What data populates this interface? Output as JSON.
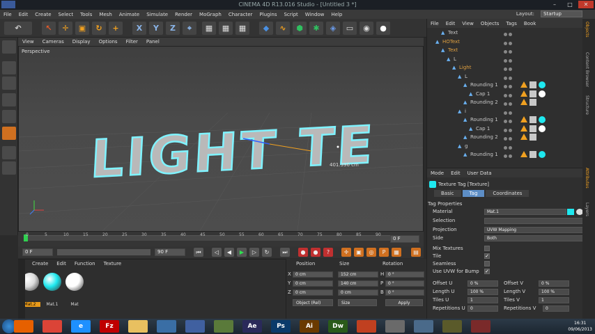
{
  "window": {
    "title": "CINEMA 4D R13.016 Studio - [Untitled 3 *]",
    "min": "–",
    "max": "□",
    "close": "✕"
  },
  "menubar": [
    "File",
    "Edit",
    "Create",
    "Select",
    "Tools",
    "Mesh",
    "Animate",
    "Simulate",
    "Render",
    "MoGraph",
    "Character",
    "Plugins",
    "Script",
    "Window",
    "Help"
  ],
  "layout": {
    "label": "Layout:",
    "value": "Startup"
  },
  "viewport": {
    "menu": [
      "View",
      "Cameras",
      "Display",
      "Options",
      "Filter",
      "Panel"
    ],
    "label": "Perspective",
    "text3d": "LIGHT TE",
    "measure": "401.396 cm",
    "accent": "#7ff3ff"
  },
  "timeline": {
    "ticks": [
      "0",
      "5",
      "10",
      "15",
      "20",
      "25",
      "30",
      "35",
      "40",
      "45",
      "50",
      "55",
      "60",
      "65",
      "70",
      "75",
      "80",
      "85",
      "90"
    ],
    "end_field": "0 F"
  },
  "playbar": {
    "start": "0 F",
    "mid": "0 F",
    "end": "90 F"
  },
  "materials": {
    "menu": [
      "Create",
      "Edit",
      "Function",
      "Texture"
    ],
    "items": [
      {
        "label": "Mat.2",
        "color": "#dcdcdc"
      },
      {
        "label": "Mat.1",
        "color": "#1ee8ef"
      },
      {
        "label": "Mat",
        "color": "#ffffff"
      }
    ]
  },
  "coords": {
    "headers": {
      "position": "Position",
      "size": "Size",
      "rotation": "Rotation"
    },
    "rows": [
      {
        "axis": "X",
        "pos": "0 cm",
        "size": "152 cm",
        "rot_axis": "H",
        "rot": "0 °"
      },
      {
        "axis": "Y",
        "pos": "0 cm",
        "size": "140 cm",
        "rot_axis": "P",
        "rot": "0 °"
      },
      {
        "axis": "Z",
        "pos": "0 cm",
        "size": "0 cm",
        "rot_axis": "B",
        "rot": "0 °"
      }
    ],
    "mode": "Object (Rel)",
    "size_mode": "Size",
    "apply": "Apply"
  },
  "objects": {
    "menu": [
      "File",
      "Edit",
      "View",
      "Objects",
      "Tags",
      "Book"
    ],
    "rows": [
      {
        "name": "Text",
        "indent": 1,
        "color": "#c8c8c8",
        "tags": []
      },
      {
        "name": "HOText",
        "indent": 0,
        "color": "#e0a040",
        "tags": []
      },
      {
        "name": "Text",
        "indent": 1,
        "color": "#e0a040",
        "tags": []
      },
      {
        "name": "L",
        "indent": 2,
        "color": "#c8c8c8",
        "tags": []
      },
      {
        "name": "Light",
        "indent": 3,
        "color": "#e0a040",
        "tags": []
      },
      {
        "name": "L",
        "indent": 4,
        "color": "#c8c8c8",
        "tags": []
      },
      {
        "name": "Rounding 1",
        "indent": 5,
        "color": "#c8c8c8",
        "tags": [
          "phong",
          "check",
          "cyan"
        ]
      },
      {
        "name": "Cap 1",
        "indent": 6,
        "color": "#c8c8c8",
        "tags": [
          "phong",
          "check",
          "white"
        ]
      },
      {
        "name": "Rounding 2",
        "indent": 5,
        "color": "#c8c8c8",
        "tags": [
          "phong",
          "check"
        ]
      },
      {
        "name": "i",
        "indent": 4,
        "color": "#c8c8c8",
        "tags": []
      },
      {
        "name": "Rounding 1",
        "indent": 5,
        "color": "#c8c8c8",
        "tags": [
          "phong",
          "check",
          "cyan"
        ]
      },
      {
        "name": "Cap 1",
        "indent": 6,
        "color": "#c8c8c8",
        "tags": [
          "phong",
          "check",
          "white"
        ]
      },
      {
        "name": "Rounding 2",
        "indent": 5,
        "color": "#c8c8c8",
        "tags": [
          "phong",
          "check"
        ]
      },
      {
        "name": "g",
        "indent": 4,
        "color": "#c8c8c8",
        "tags": []
      },
      {
        "name": "Rounding 1",
        "indent": 5,
        "color": "#c8c8c8",
        "tags": [
          "phong",
          "check",
          "cyan"
        ]
      }
    ]
  },
  "attributes": {
    "menu": [
      "Mode",
      "Edit",
      "User Data"
    ],
    "title": "Texture Tag [Texture]",
    "tabs": [
      "Basic",
      "Tag",
      "Coordinates"
    ],
    "active_tab": "Tag",
    "section": "Tag Properties",
    "props": [
      {
        "label": "Material",
        "value": "Mat.1"
      },
      {
        "label": "Selection",
        "value": ""
      },
      {
        "label": "Projection",
        "value": "UVW Mapping"
      },
      {
        "label": "Side",
        "value": "Both"
      }
    ],
    "checks": [
      {
        "label": "Mix Textures",
        "checked": false,
        "mark": ""
      },
      {
        "label": "Tile",
        "checked": true,
        "mark": "✓"
      },
      {
        "label": "Seamless",
        "checked": false,
        "mark": ""
      },
      {
        "label": "Use UVW for Bump",
        "checked": true,
        "mark": "✓"
      }
    ],
    "offset_u": {
      "label": "Offset U",
      "value": "0 %"
    },
    "offset_v": {
      "label": "Offset V",
      "value": "0 %"
    },
    "length_u": {
      "label": "Length U",
      "value": "100 %"
    },
    "length_v": {
      "label": "Length V",
      "value": "100 %"
    },
    "tiles_u": {
      "label": "Tiles U",
      "value": "1"
    },
    "tiles_v": {
      "label": "Tiles V",
      "value": "1"
    },
    "rep_u": {
      "label": "Repetitions U",
      "value": "0"
    },
    "rep_v": {
      "label": "Repetitions V",
      "value": "0"
    }
  },
  "sidetabs": [
    "Objects",
    "Content Browser",
    "Structure",
    "Attributes",
    "Layers"
  ],
  "taskbar": {
    "apps": [
      {
        "name": "firefox-icon",
        "label": "",
        "color": "#e66000"
      },
      {
        "name": "chrome-icon",
        "label": "",
        "color": "#db4437"
      },
      {
        "name": "ie-icon",
        "label": "e",
        "color": "#1e90ff"
      },
      {
        "name": "filezilla-icon",
        "label": "Fz",
        "color": "#bf0000"
      },
      {
        "name": "explorer-icon",
        "label": "",
        "color": "#e8c060"
      },
      {
        "name": "app-icon",
        "label": "",
        "color": "#3a6ea5"
      },
      {
        "name": "cinema4d-icon",
        "label": "",
        "color": "#4060a0"
      },
      {
        "name": "app2-icon",
        "label": "",
        "color": "#5a7a3a"
      },
      {
        "name": "aftereffects-icon",
        "label": "Ae",
        "color": "#2a2a5a"
      },
      {
        "name": "photoshop-icon",
        "label": "Ps",
        "color": "#0a3a6a"
      },
      {
        "name": "illustrator-icon",
        "label": "Ai",
        "color": "#6a3a00"
      },
      {
        "name": "dreamweaver-icon",
        "label": "Dw",
        "color": "#2a5a1a"
      },
      {
        "name": "app3-icon",
        "label": "",
        "color": "#c04020"
      },
      {
        "name": "app4-icon",
        "label": "",
        "color": "#6a6a6a"
      },
      {
        "name": "app5-icon",
        "label": "",
        "color": "#4a6a8a"
      },
      {
        "name": "app6-icon",
        "label": "",
        "color": "#5a5a2a"
      },
      {
        "name": "app7-icon",
        "label": "",
        "color": "#7a2a2a"
      }
    ],
    "time": "16:31",
    "date": "09/06/2013"
  }
}
